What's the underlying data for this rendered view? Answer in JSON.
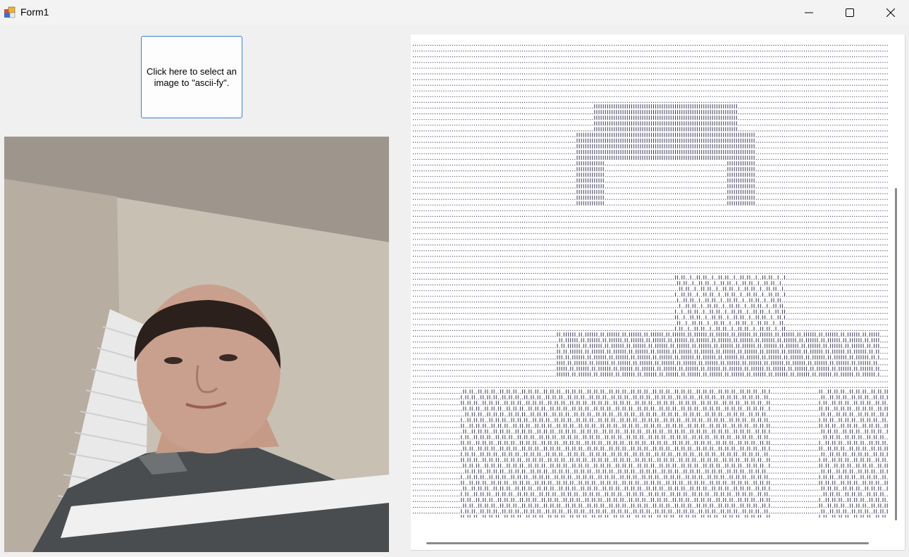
{
  "window": {
    "title": "Form1",
    "icon": "winforms-app-icon",
    "controls": {
      "minimize_icon": "minimize-icon",
      "maximize_icon": "maximize-icon",
      "close_icon": "close-icon"
    }
  },
  "select_button": {
    "label": "Click here to select an image to \"ascii-fy\"."
  },
  "photo": {
    "description_icon": "selected-photo"
  },
  "ascii_output": {
    "characters": [
      ".",
      ":",
      "|",
      "!"
    ],
    "background": "#ffffff",
    "ink": "#3c3c5a"
  },
  "colors": {
    "accent": "#3a80d0",
    "form_bg": "#f0f0f0"
  }
}
